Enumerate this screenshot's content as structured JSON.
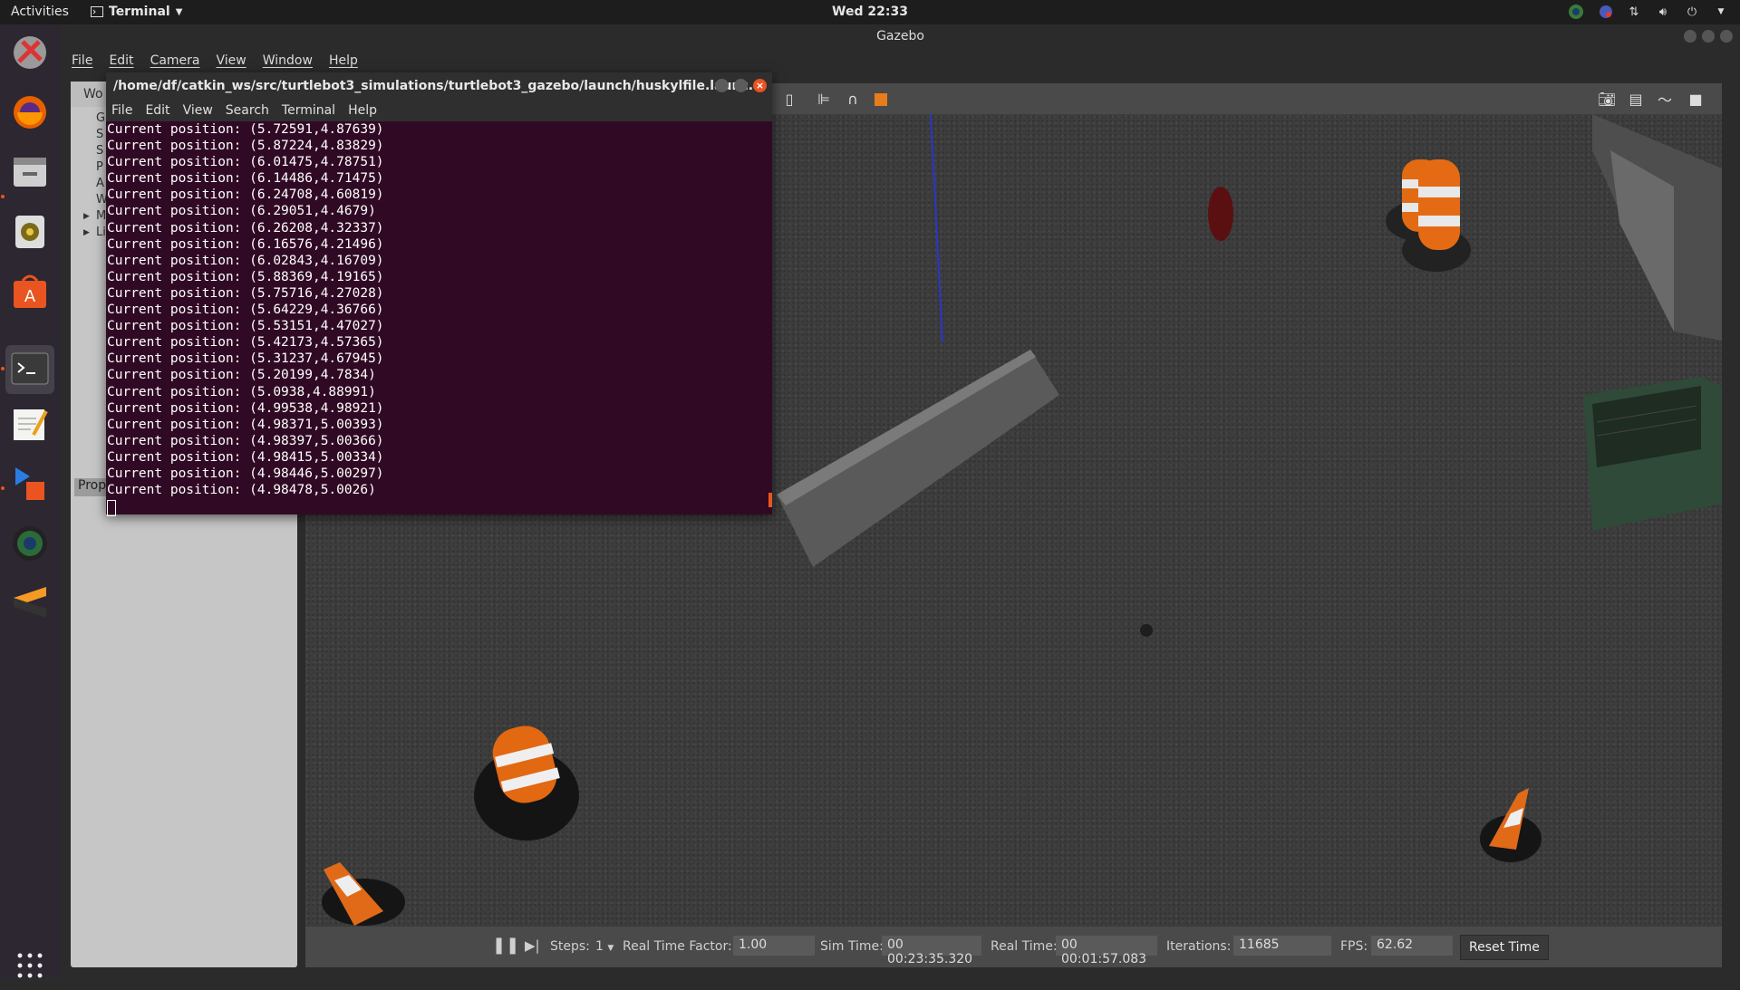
{
  "topbar": {
    "activities": "Activities",
    "app_menu": "Terminal",
    "clock": "Wed 22:33"
  },
  "dock": {
    "items": [
      {
        "icon": "ros-tools-icon"
      },
      {
        "icon": "firefox-icon"
      },
      {
        "icon": "files-icon"
      },
      {
        "icon": "rhythmbox-icon"
      },
      {
        "icon": "software-center-icon"
      },
      {
        "icon": "terminal-icon"
      },
      {
        "icon": "text-editor-icon"
      },
      {
        "icon": "vlc-icon"
      },
      {
        "icon": "webcam-icon"
      },
      {
        "icon": "sublime-icon"
      },
      {
        "icon": "show-apps-icon"
      }
    ]
  },
  "gazebo": {
    "title": "Gazebo",
    "menu": [
      "File",
      "Edit",
      "Camera",
      "View",
      "Window",
      "Help"
    ],
    "left_panel": {
      "tab": "Wo",
      "tree": [
        "G",
        "S",
        "S",
        "P",
        "A",
        "W",
        "M",
        "Li"
      ],
      "properties": "Prop"
    },
    "bottom": {
      "steps_label": "Steps:",
      "steps_value": "1",
      "rtf_label": "Real Time Factor:",
      "rtf_value": "1.00",
      "sim_label": "Sim Time:",
      "sim_value": "00 00:23:35.320",
      "real_label": "Real Time:",
      "real_value": "00 00:01:57.083",
      "iter_label": "Iterations:",
      "iter_value": "11685",
      "fps_label": "FPS:",
      "fps_value": "62.62",
      "reset_label": "Reset Time"
    }
  },
  "terminal": {
    "title": "/home/df/catkin_ws/src/turtlebot3_simulations/turtlebot3_gazebo/launch/huskylfile.launc...",
    "menu": [
      "File",
      "Edit",
      "View",
      "Search",
      "Terminal",
      "Help"
    ],
    "lines": [
      "Current position: (5.72591,4.87639)",
      "Current position: (5.87224,4.83829)",
      "Current position: (6.01475,4.78751)",
      "Current position: (6.14486,4.71475)",
      "Current position: (6.24708,4.60819)",
      "Current position: (6.29051,4.4679)",
      "Current position: (6.26208,4.32337)",
      "Current position: (6.16576,4.21496)",
      "Current position: (6.02843,4.16709)",
      "Current position: (5.88369,4.19165)",
      "Current position: (5.75716,4.27028)",
      "Current position: (5.64229,4.36766)",
      "Current position: (5.53151,4.47027)",
      "Current position: (5.42173,4.57365)",
      "Current position: (5.31237,4.67945)",
      "Current position: (5.20199,4.7834)",
      "Current position: (5.0938,4.88991)",
      "Current position: (4.99538,4.98921)",
      "Current position: (4.98371,5.00393)",
      "Current position: (4.98397,5.00366)",
      "Current position: (4.98415,5.00334)",
      "Current position: (4.98446,5.00297)",
      "Current position: (4.98478,5.0026)"
    ]
  }
}
